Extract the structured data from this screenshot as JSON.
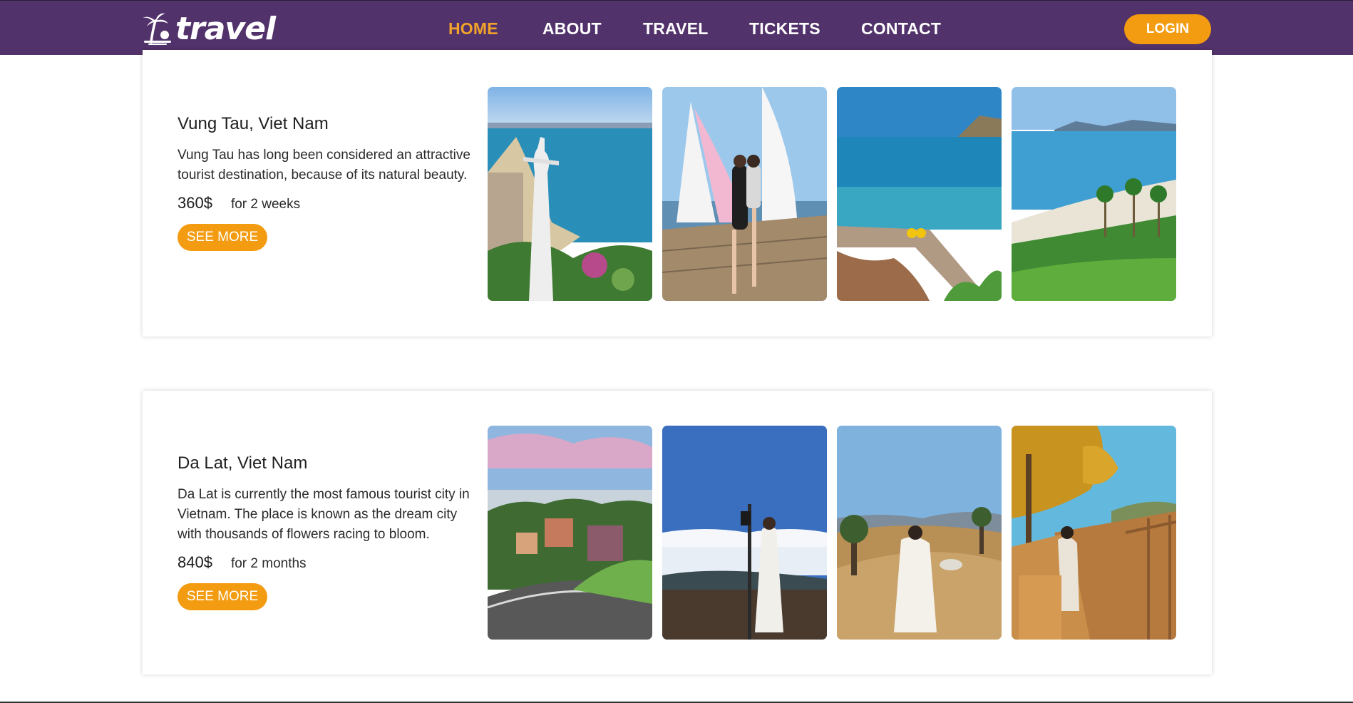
{
  "brand": {
    "logo_text": "travel"
  },
  "nav": {
    "items": [
      {
        "label": "HOME",
        "active": true
      },
      {
        "label": "ABOUT",
        "active": false
      },
      {
        "label": "TRAVEL",
        "active": false
      },
      {
        "label": "TICKETS",
        "active": false
      },
      {
        "label": "CONTACT",
        "active": false
      }
    ],
    "login_label": "LOGIN"
  },
  "colors": {
    "navbar_bg": "#52326a",
    "accent": "#f39c12",
    "active_nav": "#f2a32b"
  },
  "destinations": [
    {
      "title": "Vung Tau, Viet Nam",
      "description": "Vung Tau has long been considered an attractive tourist destination, because of its natural beauty.",
      "price": "360$",
      "duration": "for 2 weeks",
      "button_label": "SEE MORE",
      "photos": [
        "coastal-statue-photo",
        "sailboat-photo",
        "pier-sea-photo",
        "palm-beach-photo"
      ]
    },
    {
      "title": "Da Lat, Viet Nam",
      "description": "Da Lat is currently the most famous tourist city in Vietnam. The place is known as the dream city with thousands of flowers racing to bloom.",
      "price": "840$",
      "duration": "for 2 months",
      "button_label": "SEE MORE",
      "photos": [
        "city-hill-photo",
        "lamp-post-clouds-photo",
        "hill-grass-photo",
        "wooden-walkway-photo"
      ]
    }
  ]
}
